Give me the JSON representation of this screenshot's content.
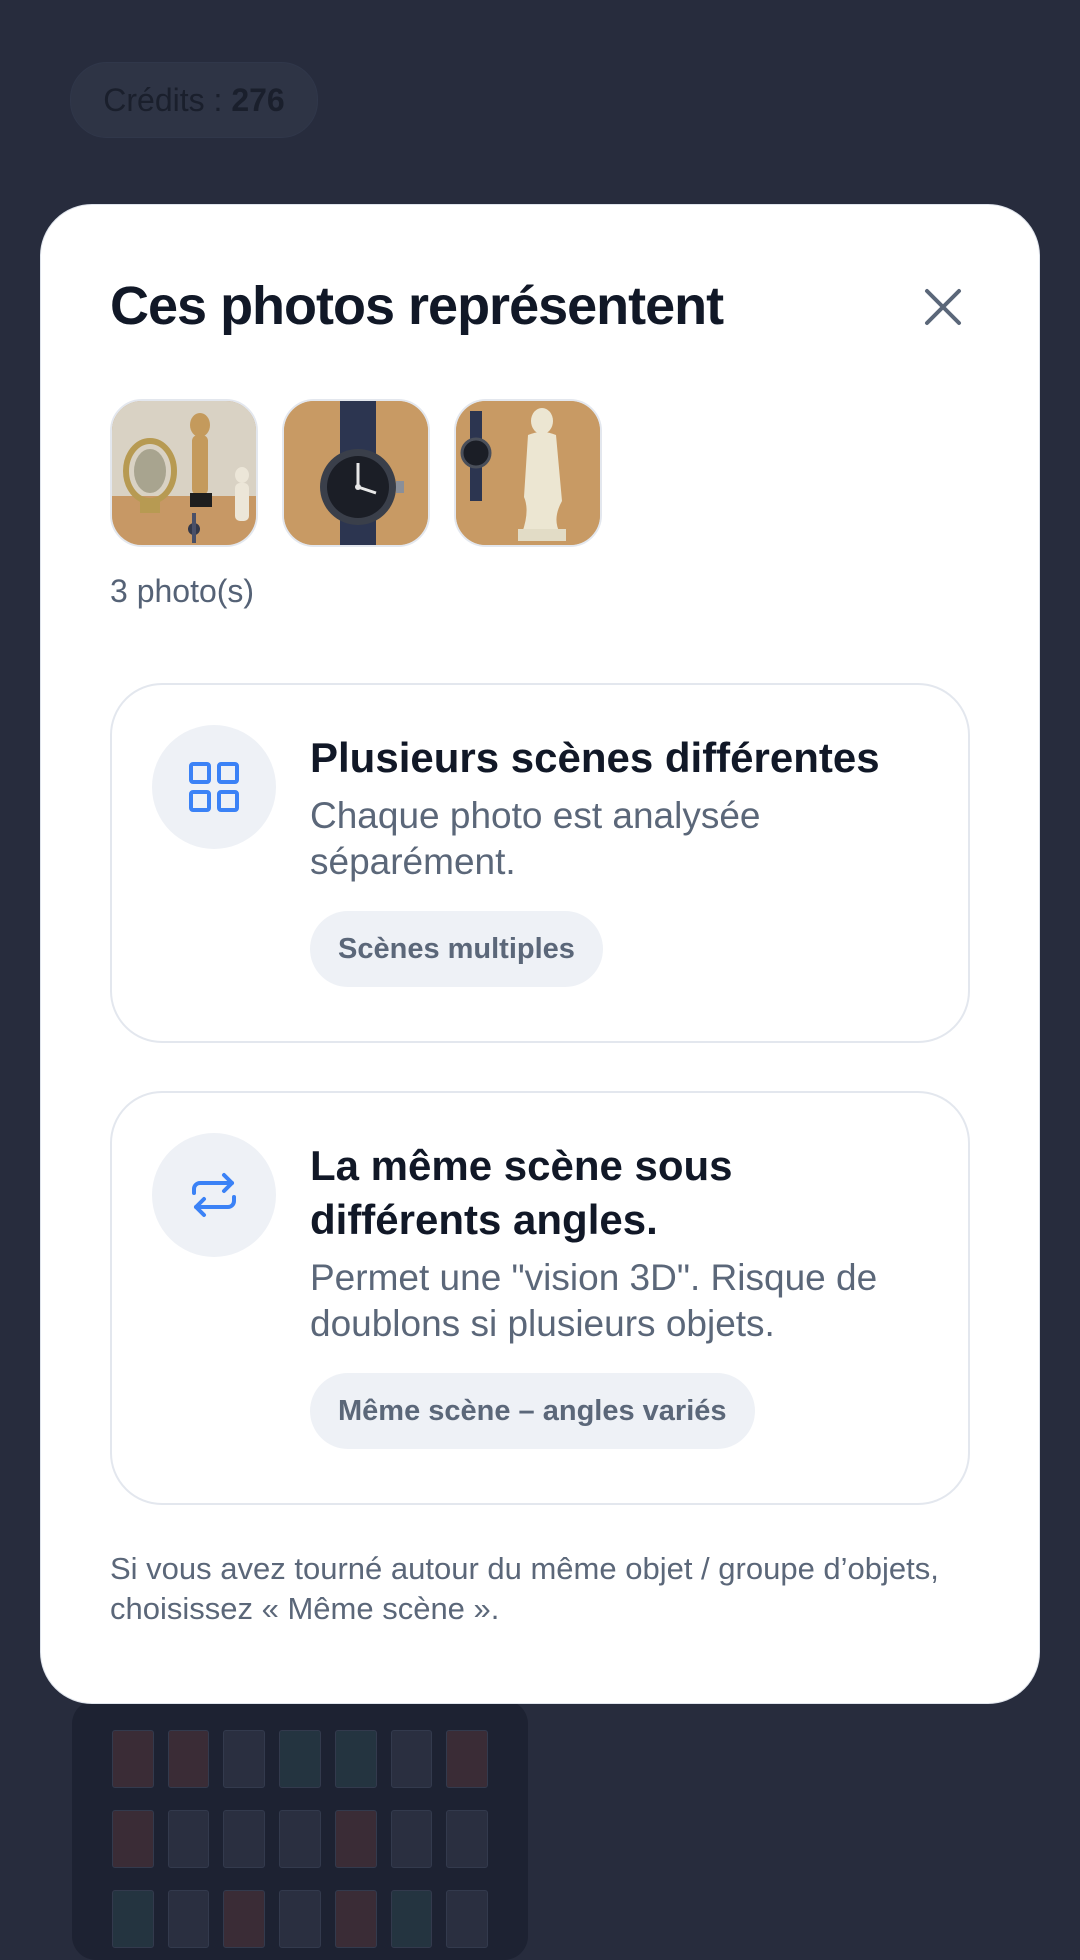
{
  "background": {
    "credits_label": "Crédits : ",
    "credits_value": "276"
  },
  "modal": {
    "title": "Ces photos représentent",
    "close_icon": "close-icon",
    "thumbnails": [
      {
        "icon": "photo-thumbnail"
      },
      {
        "icon": "photo-thumbnail"
      },
      {
        "icon": "photo-thumbnail"
      }
    ],
    "photo_count": "3 photo(s)",
    "options": [
      {
        "icon": "grid-icon",
        "title": "Plusieurs scènes différentes",
        "description": "Chaque photo est analysée séparément.",
        "chip": "Scènes multiples"
      },
      {
        "icon": "repeat-arrows-icon",
        "title": "La même scène sous différents angles.",
        "description": "Permet une \"vision 3D\". Risque de doublons si plusieurs objets.",
        "chip": "Même scène – angles variés"
      }
    ],
    "hint": "Si vous avez tourné autour du même objet / groupe d’objets, choisissez « Même scène »."
  },
  "colors": {
    "accent": "#3b82f6",
    "backdrop": "#272c3d",
    "title": "#111827",
    "muted": "#5b6779"
  }
}
